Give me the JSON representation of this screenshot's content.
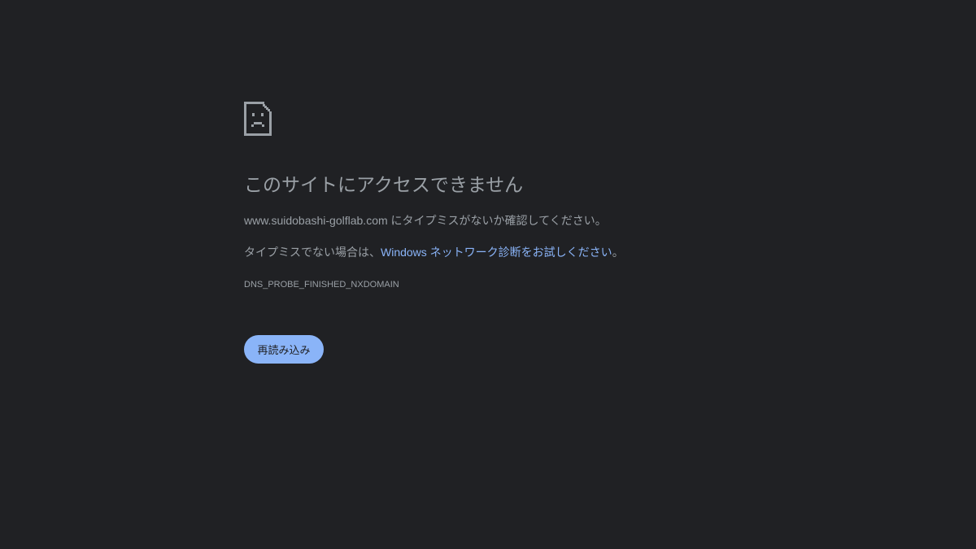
{
  "icons": {
    "error_icon": "sad-page-icon"
  },
  "colors": {
    "background": "#202124",
    "text": "#9aa0a6",
    "link": "#8ab4f8",
    "button_bg": "#8ab4f8",
    "button_text": "#202124"
  },
  "error": {
    "title": "このサイトにアクセスできません",
    "line1": "www.suidobashi-golflab.com にタイプミスがないか確認してください。",
    "line2_prefix": "タイプミスでない場合は、",
    "line2_link": "Windows ネットワーク診断をお試しください",
    "line2_suffix": "。",
    "code": "DNS_PROBE_FINISHED_NXDOMAIN"
  },
  "actions": {
    "reload_label": "再読み込み"
  }
}
